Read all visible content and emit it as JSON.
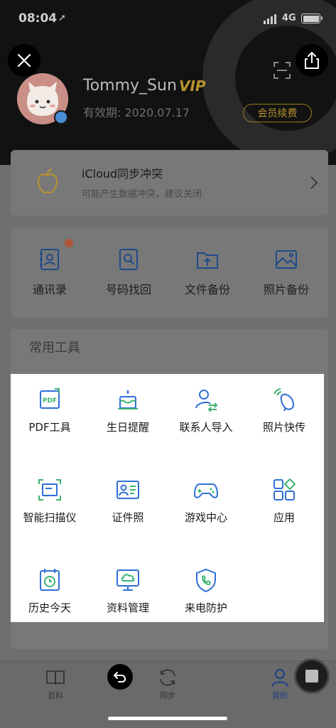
{
  "status_bar": {
    "time": "08:04",
    "location_glyph": "➚",
    "network": "4G"
  },
  "header": {
    "username": "Tommy_Sun",
    "vip": "VIP",
    "expiry": "有效期: 2020.07.17",
    "renew_label": "会员续费"
  },
  "icloud": {
    "title": "iCloud同步冲突",
    "subtitle": "可能产生数据冲突，建议关闭"
  },
  "backup_items": [
    {
      "label": "通讯录",
      "icon": "contacts-book-icon",
      "has_badge": true
    },
    {
      "label": "号码找回",
      "icon": "number-recovery-icon"
    },
    {
      "label": "文件备份",
      "icon": "folder-upload-icon"
    },
    {
      "label": "照片备份",
      "icon": "photo-icon"
    }
  ],
  "tools": {
    "title": "常用工具",
    "items": [
      {
        "label": "PDF工具",
        "icon": "pdf-icon"
      },
      {
        "label": "生日提醒",
        "icon": "birthday-cake-icon"
      },
      {
        "label": "联系人导入",
        "icon": "contact-import-icon"
      },
      {
        "label": "照片快传",
        "icon": "photo-transfer-icon"
      },
      {
        "label": "智能扫描仪",
        "icon": "scanner-icon"
      },
      {
        "label": "证件照",
        "icon": "id-card-icon"
      },
      {
        "label": "游戏中心",
        "icon": "gamepad-icon"
      },
      {
        "label": "应用",
        "icon": "apps-icon"
      },
      {
        "label": "历史今天",
        "icon": "history-calendar-icon"
      },
      {
        "label": "资料管理",
        "icon": "cloud-monitor-icon"
      },
      {
        "label": "来电防护",
        "icon": "call-shield-icon"
      }
    ]
  },
  "tabs": [
    {
      "label": "百科",
      "icon": "book-icon"
    },
    {
      "label": "同步",
      "icon": "sync-icon"
    },
    {
      "label": "我的",
      "icon": "profile-icon",
      "active": true
    }
  ],
  "colors": {
    "accent_blue": "#2f6fd6",
    "accent_green": "#3cb371",
    "vip_gold": "#b8932f",
    "active_tab": "#1f3c88"
  }
}
